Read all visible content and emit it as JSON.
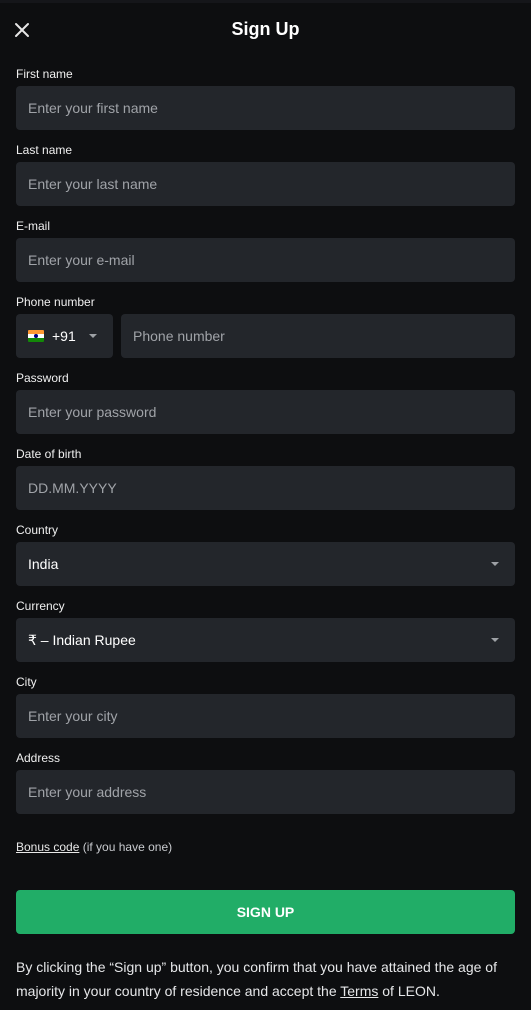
{
  "header": {
    "title": "Sign Up",
    "close_icon": "close-icon"
  },
  "fields": {
    "first_name": {
      "label": "First name",
      "placeholder": "Enter your first name"
    },
    "last_name": {
      "label": "Last name",
      "placeholder": "Enter your last name"
    },
    "email": {
      "label": "E-mail",
      "placeholder": "Enter your e-mail"
    },
    "phone": {
      "label": "Phone number",
      "country_code": "+91",
      "flag": "india-flag-icon",
      "placeholder": "Phone number"
    },
    "password": {
      "label": "Password",
      "placeholder": "Enter your password"
    },
    "dob": {
      "label": "Date of birth",
      "placeholder": "DD.MM.YYYY"
    },
    "country": {
      "label": "Country",
      "value": "India"
    },
    "currency": {
      "label": "Currency",
      "value": "₹ – Indian Rupee"
    },
    "city": {
      "label": "City",
      "placeholder": "Enter your city"
    },
    "address": {
      "label": "Address",
      "placeholder": "Enter your address"
    }
  },
  "bonus": {
    "link": "Bonus code",
    "suffix": " (if you have one)"
  },
  "signup_button": {
    "label": "SIGN UP",
    "color": "#21ad67"
  },
  "terms": {
    "before": "By clicking the “Sign up” button, you confirm that you have attained the age of majority in your country of residence and accept the ",
    "link": "Terms",
    "after": " of LEON."
  }
}
